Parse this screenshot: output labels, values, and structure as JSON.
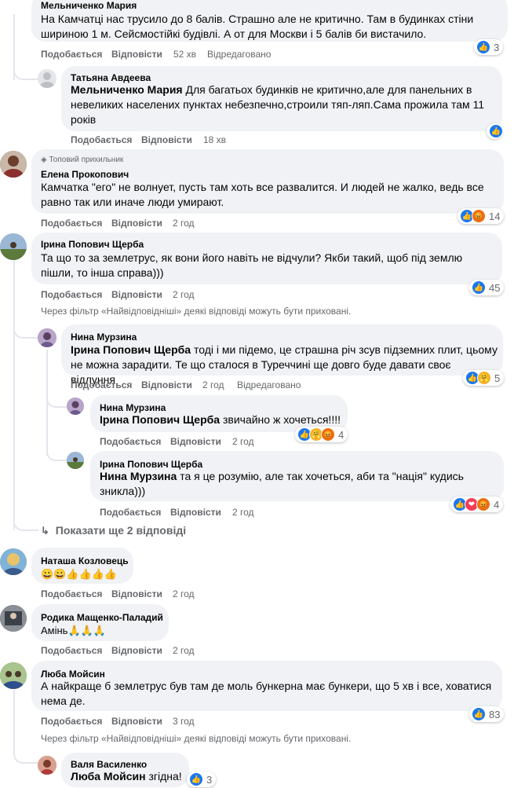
{
  "labels": {
    "like": "Подобається",
    "reply": "Відповісти"
  },
  "comments": [
    {
      "author": "Мельниченко Мария",
      "text": "На Камчатці нас трусило до 8 балів. Страшно але не критично. Там в будинках стіни шириною 1 м. Сейсмостійкі будівлі. А от для Москви і 5 балів би вистачило.",
      "time": "52 хв",
      "edited": "Відредаговано",
      "reactions": "3"
    },
    {
      "author": "Татьяна Авдеева",
      "mention": "Мельниченко Мария",
      "text": "Для багатьох будинків не критично,але для панельних в невеликих населених пунктах небезпечно,строили тяп-ляп.Сама прожила там 11 років",
      "time": "18 хв"
    },
    {
      "badge": "Топовий прихильник",
      "author": "Елена Прокопович",
      "text": "Камчатка \"его\" не волнует, пусть там хоть все развалится. И людей не жалко, ведь все равно так или иначе люди умирают.",
      "time": "2 год",
      "reactions": "14"
    },
    {
      "author": "Ірина Попович Щерба",
      "text": "Та що то за землетрус, як вони його навіть не відчули? Якби такий, щоб під землю пішли, то інша справа)))",
      "time": "2 год",
      "reactions": "45"
    },
    {
      "author": "Нина Мурзина",
      "mention": "Ірина Попович Щерба",
      "text": "тоді і ми підемо, це страшна річ зсув підземних плит, цьому не можна зарадити. Те що сталося в Туреччині ще довго буде давати своє відлуння",
      "time": "2 год",
      "edited": "Відредаговано",
      "reactions": "5"
    },
    {
      "author": "Нина Мурзина",
      "mention": "Ірина Попович Щерба",
      "text": "звичайно ж хочеться!!!!",
      "time": "2 год",
      "reactions": "4"
    },
    {
      "author": "Ірина Попович Щерба",
      "mention": "Нина Мурзина",
      "text": "та я це розумію, але так хочеться, аби та \"нація\" кудись зникла)))",
      "time": "2 год",
      "reactions": "4"
    },
    {
      "author": "Наташа Козловець",
      "text": "😀😀👍👍👍👍",
      "time": "2 год"
    },
    {
      "author": "Родика Мащенко-Паладий",
      "text": "Амінь🙏🙏🙏",
      "time": "2 год"
    },
    {
      "author": "Люба Мойсин",
      "text": "А найкраще б землетрус був там де моль бункерна має бункери, що 5 хв і все, ховатися нема де.",
      "time": "3 год",
      "reactions": "83"
    },
    {
      "author": "Валя Василенко",
      "mention": "Люба Мойсин",
      "text": "згідна!",
      "reactions": "3"
    }
  ],
  "filter_note": "Через фільтр «Найвідповідніші» деякі відповіді можуть бути приховані.",
  "show_more": "Показати ще 2 відповіді",
  "colors": {
    "bubble": "#f0f2f5",
    "meta": "#65676b",
    "like": "#1877f2",
    "angry": "#e9710f",
    "love": "#f33e58"
  }
}
